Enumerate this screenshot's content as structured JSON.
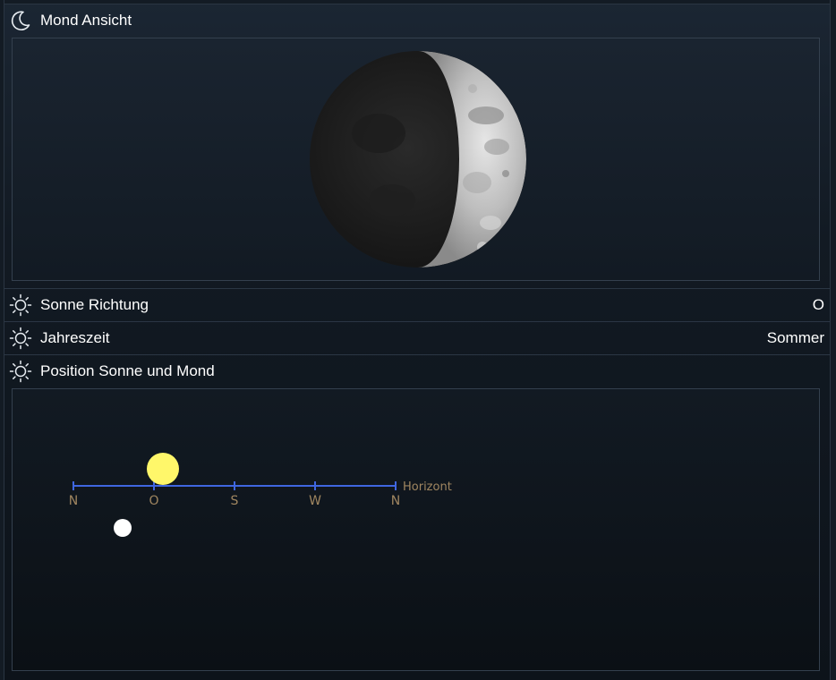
{
  "moon_view": {
    "title": "Mond Ansicht",
    "icon": "moon-icon",
    "phase": "waxing crescent"
  },
  "sun_direction": {
    "label": "Sonne Richtung",
    "value": "O",
    "icon": "sun-icon"
  },
  "season": {
    "label": "Jahreszeit",
    "value": "Sommer",
    "icon": "sun-icon"
  },
  "position": {
    "title": "Position Sonne und Mond",
    "icon": "sun-icon",
    "directions": [
      "N",
      "O",
      "S",
      "W",
      "N"
    ],
    "horizon_label": "Horizont",
    "sun": {
      "direction_deg": 100,
      "altitude": "above",
      "color": "#fff76a"
    },
    "moon": {
      "direction_deg": 55,
      "altitude": "below",
      "color": "#ffffff"
    }
  },
  "colors": {
    "axis": "#3f66e0",
    "axis_text": "#a08660",
    "border": "#34404e"
  }
}
